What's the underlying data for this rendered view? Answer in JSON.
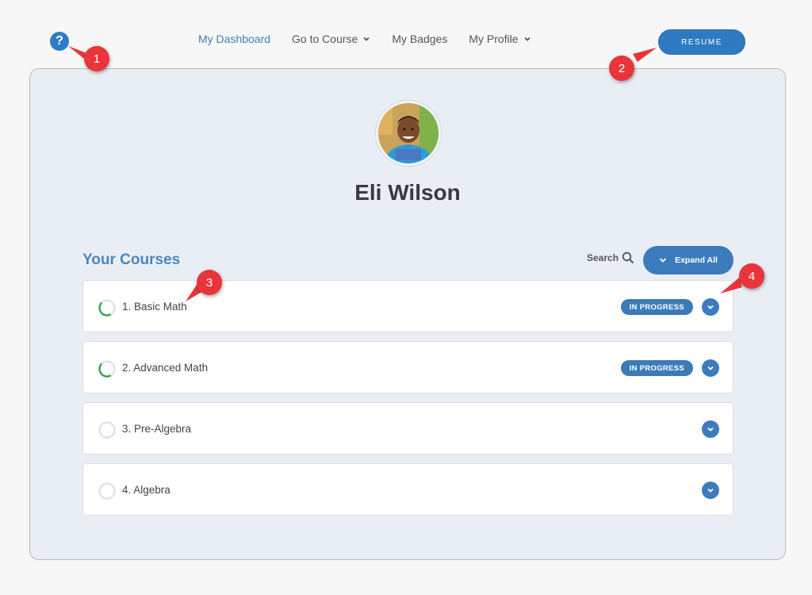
{
  "nav": {
    "items": [
      {
        "label": "My Dashboard",
        "active": true,
        "has_dropdown": false
      },
      {
        "label": "Go to Course",
        "active": false,
        "has_dropdown": true
      },
      {
        "label": "My Badges",
        "active": false,
        "has_dropdown": false
      },
      {
        "label": "My Profile",
        "active": false,
        "has_dropdown": true
      }
    ]
  },
  "help": {
    "icon": "question-circle-icon",
    "symbol": "?"
  },
  "resume": {
    "label": "RESUME"
  },
  "profile": {
    "name": "Eli Wilson"
  },
  "courses": {
    "title": "Your Courses",
    "search_label": "Search",
    "expand_all_label": "Expand All",
    "items": [
      {
        "title": "1. Basic Math",
        "status": "IN PROGRESS",
        "progress": 0.45
      },
      {
        "title": "2. Advanced Math",
        "status": "IN PROGRESS",
        "progress": 0.45
      },
      {
        "title": "3. Pre-Algebra",
        "status": "",
        "progress": 0
      },
      {
        "title": "4. Algebra",
        "status": "",
        "progress": 0
      }
    ]
  },
  "markers": [
    "1",
    "2",
    "3",
    "4"
  ],
  "colors": {
    "accent": "#2f7bc3",
    "progress_ring": "#3aa655",
    "marker": "#e8353a"
  }
}
